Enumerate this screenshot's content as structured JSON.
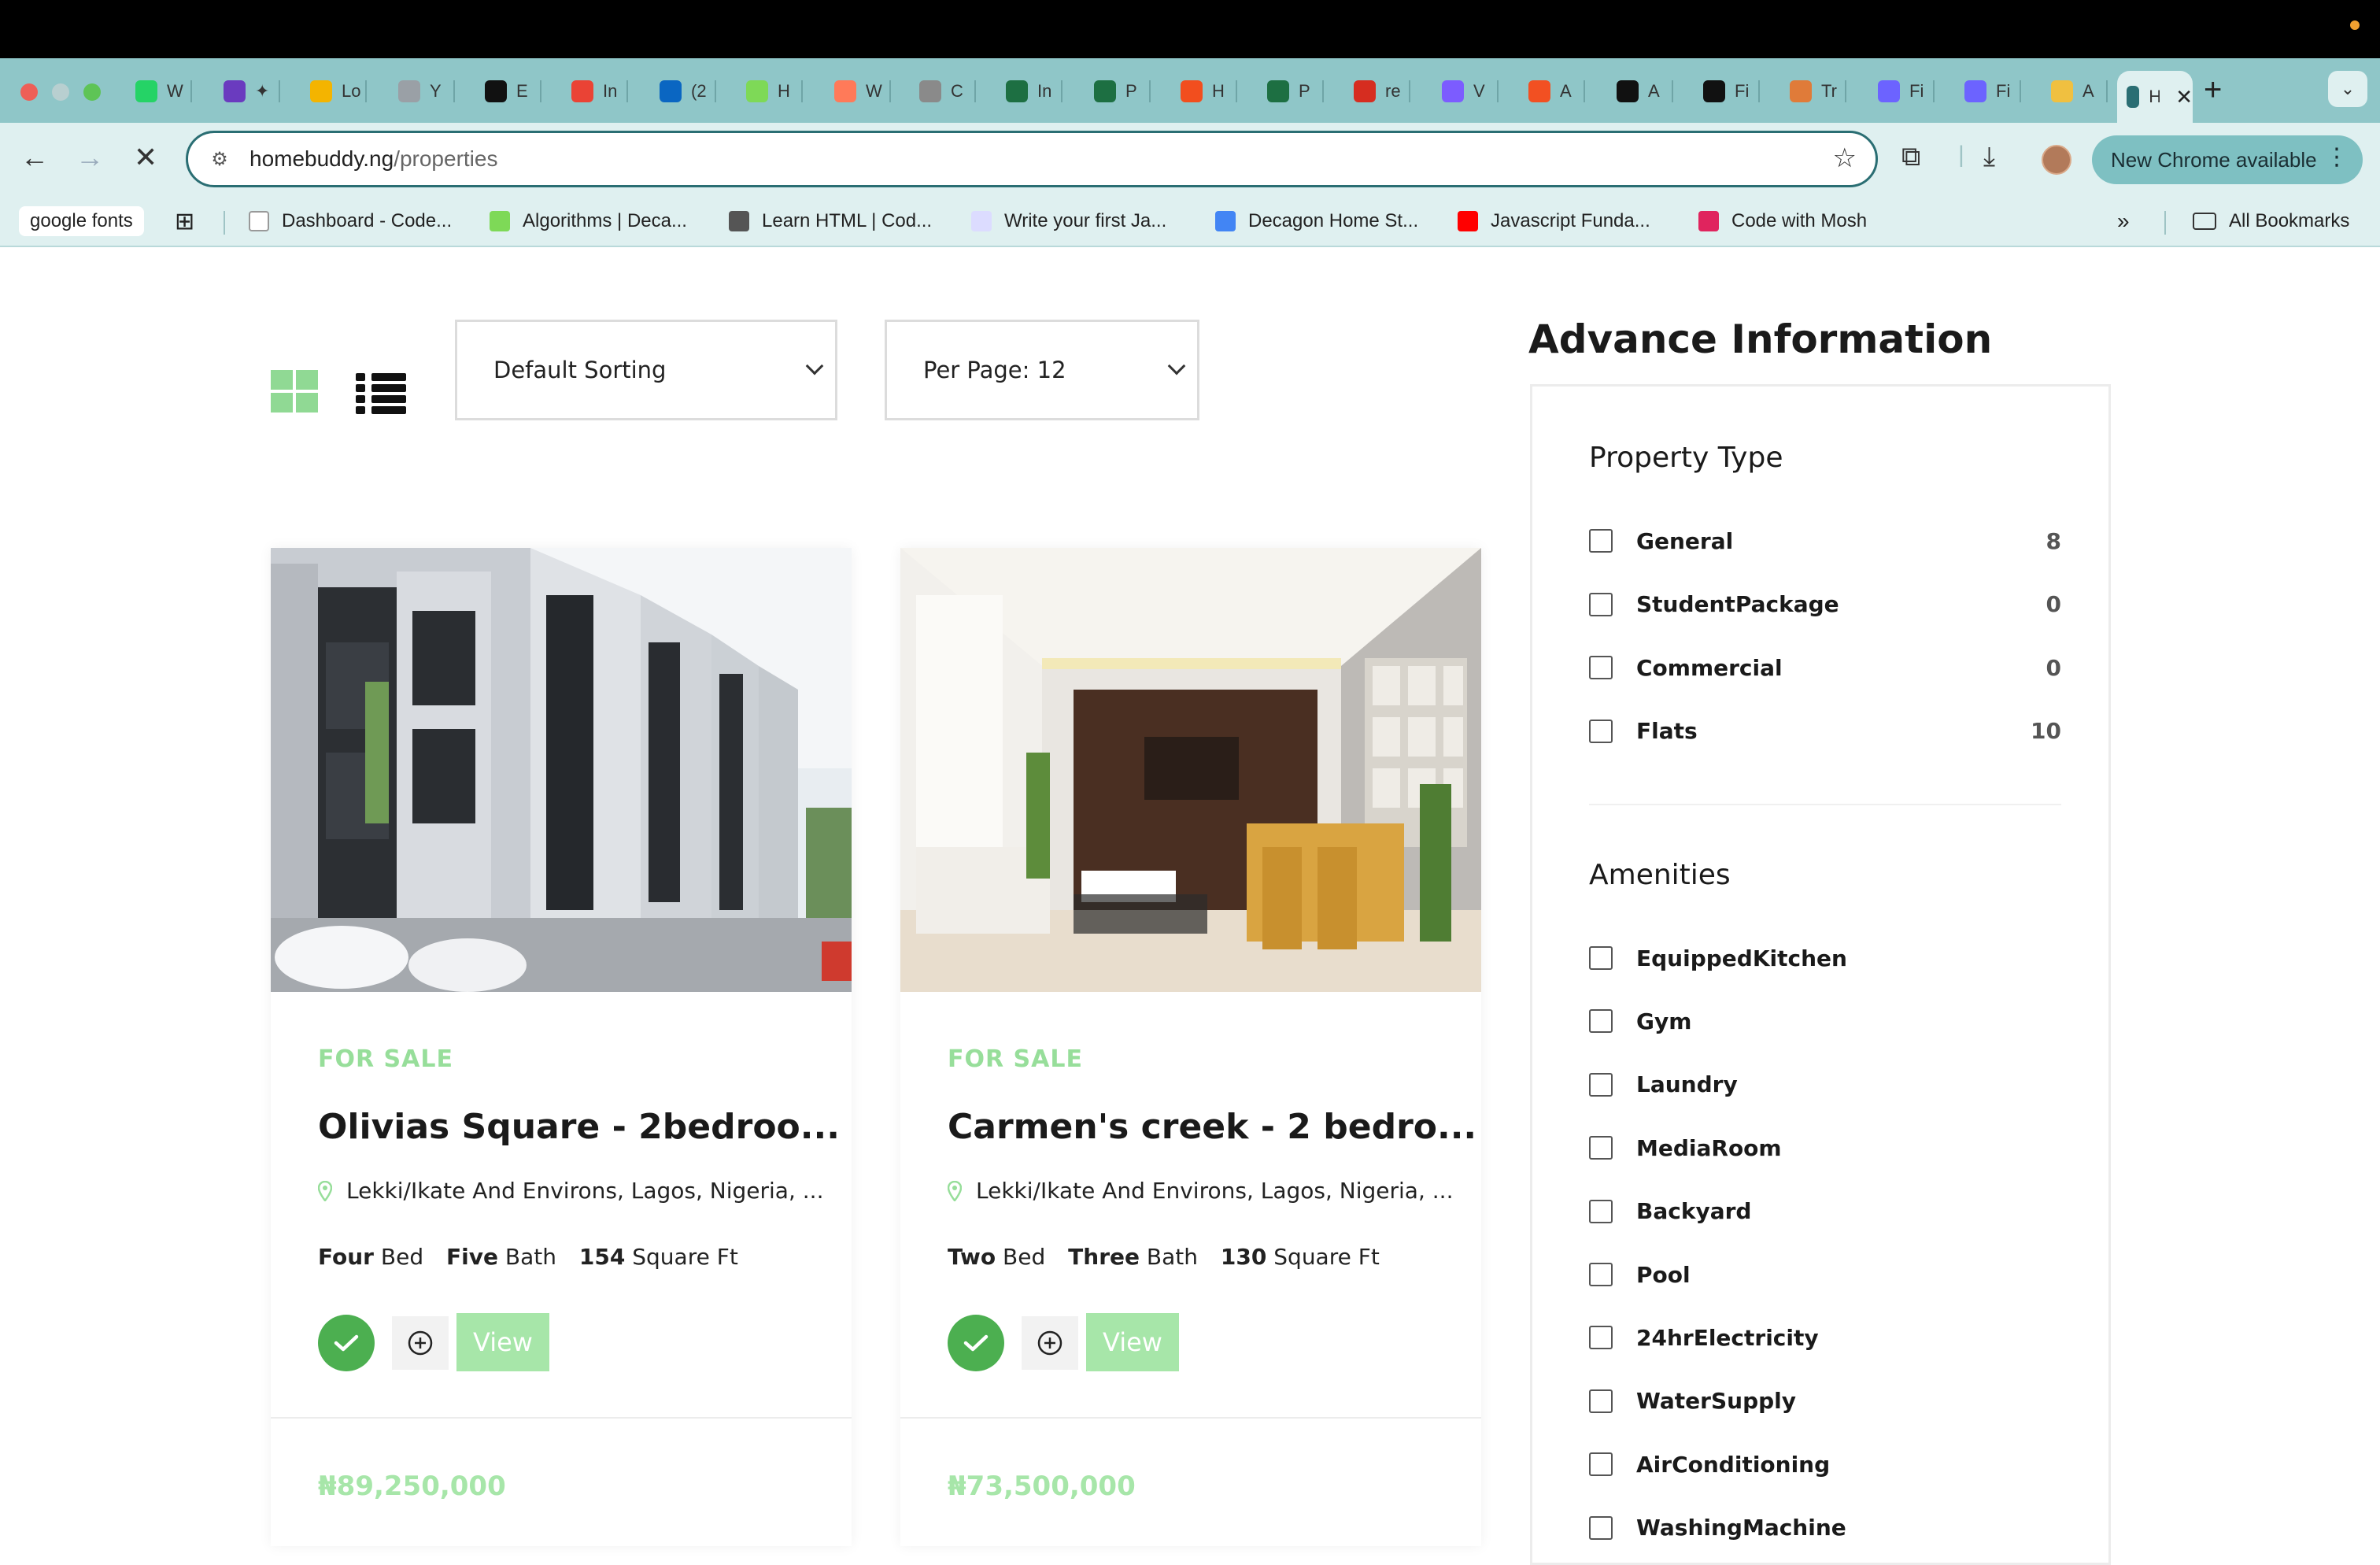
{
  "browser": {
    "tabs": [
      {
        "icon": "whatsapp-icon",
        "label": "W",
        "color": "#25d366"
      },
      {
        "icon": "forms-icon",
        "label": "✦",
        "color": "#6a3bbf"
      },
      {
        "icon": "drive-icon",
        "label": "Lo",
        "color": "#f4b400"
      },
      {
        "icon": "circle-icon",
        "label": "Y",
        "color": "#9aa0a6"
      },
      {
        "icon": "openai-icon",
        "label": "E",
        "color": "#111111"
      },
      {
        "icon": "gmail-icon",
        "label": "In",
        "color": "#ea4335"
      },
      {
        "icon": "linkedin-icon",
        "label": "(2",
        "color": "#0a66c2"
      },
      {
        "icon": "clover-icon",
        "label": "H",
        "color": "#7ed957"
      },
      {
        "icon": "pin-icon",
        "label": "W",
        "color": "#ff7a59"
      },
      {
        "icon": "shell-icon",
        "label": "C",
        "color": "#8a8a8a"
      },
      {
        "icon": "excel-icon",
        "label": "In",
        "color": "#1d6f42"
      },
      {
        "icon": "excel-icon",
        "label": "P",
        "color": "#1d6f42"
      },
      {
        "icon": "figma-icon",
        "label": "H",
        "color": "#f24e1e"
      },
      {
        "icon": "excel-icon",
        "label": "P",
        "color": "#1d6f42"
      },
      {
        "icon": "red-square-icon",
        "label": "re",
        "color": "#d62d20"
      },
      {
        "icon": "vuetify-icon",
        "label": "V",
        "color": "#7c5cff"
      },
      {
        "icon": "microsoft-icon",
        "label": "A",
        "color": "#f25022"
      },
      {
        "icon": "hex-icon",
        "label": "A",
        "color": "#111111"
      },
      {
        "icon": "hex-icon",
        "label": "Fi",
        "color": "#111111"
      },
      {
        "icon": "leaf-icon",
        "label": "Tr",
        "color": "#e07b39"
      },
      {
        "icon": "heart-icon",
        "label": "Fi",
        "color": "#6c63ff"
      },
      {
        "icon": "heart-icon",
        "label": "Fi",
        "color": "#6c63ff"
      },
      {
        "icon": "arrow-icon",
        "label": "A",
        "color": "#f0c040"
      },
      {
        "icon": "house-icon",
        "label": "H",
        "color": "#2a6e73"
      }
    ],
    "url_host": "homebuddy.ng",
    "url_path": "/properties",
    "new_chrome_label": "New Chrome available",
    "bookmarks": [
      {
        "label": "google fonts"
      },
      {
        "label": "Dashboard - Code...",
        "color": "#ffffff"
      },
      {
        "label": "Algorithms | Deca...",
        "color": "#7ed957"
      },
      {
        "label": "Learn HTML | Cod...",
        "color": "#555555"
      },
      {
        "label": "Write your first Ja...",
        "color": "#dcdcff"
      },
      {
        "label": "Decagon Home St...",
        "color": "#4285f4"
      },
      {
        "label": "Javascript Funda...",
        "color": "#ff0000"
      },
      {
        "label": "Code with Mosh",
        "color": "#e0245e"
      }
    ],
    "all_bookmarks_label": "All Bookmarks"
  },
  "controls": {
    "sorting_label": "Default Sorting",
    "per_page_label": "Per Page: 12"
  },
  "listings": [
    {
      "status": "FOR SALE",
      "title": "Olivias Square - 2bedroo...",
      "location": "Lekki/Ikate And Environs, Lagos, Nigeria, ...",
      "beds_value": "Four",
      "beds_unit": "Bed",
      "baths_value": "Five",
      "baths_unit": "Bath",
      "area_value": "154",
      "area_unit": "Square Ft",
      "view_label": "View",
      "price": "₦89,250,000"
    },
    {
      "status": "FOR SALE",
      "title": "Carmen's creek - 2 bedro...",
      "location": "Lekki/Ikate And Environs, Lagos, Nigeria, ...",
      "beds_value": "Two",
      "beds_unit": "Bed",
      "baths_value": "Three",
      "baths_unit": "Bath",
      "area_value": "130",
      "area_unit": "Square Ft",
      "view_label": "View",
      "price": "₦73,500,000"
    }
  ],
  "sidebar": {
    "title": "Advance Information",
    "property_type_title": "Property Type",
    "property_types": [
      {
        "label": "General",
        "count": "8"
      },
      {
        "label": "StudentPackage",
        "count": "0"
      },
      {
        "label": "Commercial",
        "count": "0"
      },
      {
        "label": "Flats",
        "count": "10"
      }
    ],
    "amenities_title": "Amenities",
    "amenities": [
      {
        "label": "EquippedKitchen"
      },
      {
        "label": "Gym"
      },
      {
        "label": "Laundry"
      },
      {
        "label": "MediaRoom"
      },
      {
        "label": "Backyard"
      },
      {
        "label": "Pool"
      },
      {
        "label": "24hrElectricity"
      },
      {
        "label": "WaterSupply"
      },
      {
        "label": "AirConditioning"
      },
      {
        "label": "WashingMachine"
      }
    ]
  },
  "colors": {
    "accent_green": "#97de9a",
    "check_green": "#4caf50",
    "browser_teal": "#8fc6c8"
  }
}
